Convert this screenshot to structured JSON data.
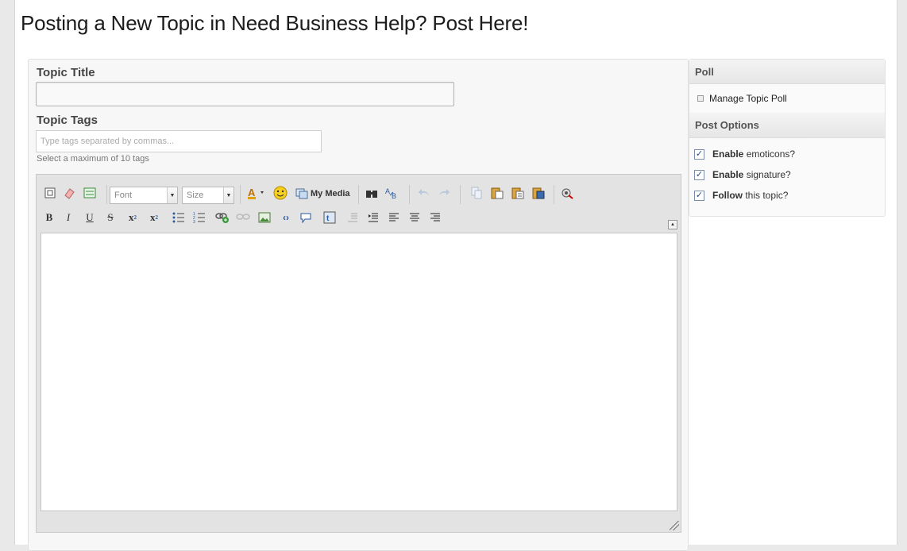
{
  "page": {
    "title": "Posting a New Topic in Need Business Help? Post Here!"
  },
  "form": {
    "topic_title_label": "Topic Title",
    "topic_title_value": "",
    "topic_tags_label": "Topic Tags",
    "topic_tags_placeholder": "Type tags separated by commas...",
    "topic_tags_help": "Select a maximum of 10 tags"
  },
  "editor": {
    "font_combo": "Font",
    "size_combo": "Size",
    "my_media_label": "My Media",
    "content": ""
  },
  "sidebar": {
    "poll_heading": "Poll",
    "manage_poll_link": "Manage Topic Poll",
    "options_heading": "Post Options",
    "options": [
      {
        "bold": "Enable",
        "rest": " emoticons?",
        "checked": true
      },
      {
        "bold": "Enable",
        "rest": " signature?",
        "checked": true
      },
      {
        "bold": "Follow",
        "rest": " this topic?",
        "checked": true
      }
    ]
  },
  "colors": {
    "checkbox_check": "#2a4a7a",
    "panel_bg": "#f7f7f7"
  }
}
